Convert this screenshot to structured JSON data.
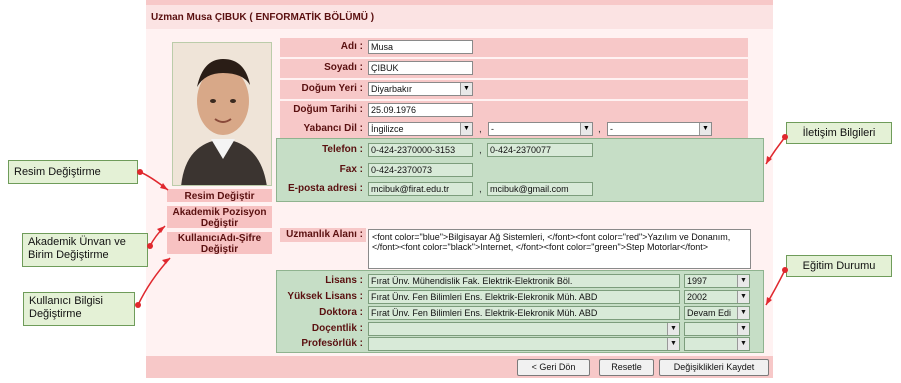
{
  "header": {
    "title": "Uzman  Musa ÇIBUK  ( ENFORMATİK BÖLÜMÜ )"
  },
  "sidebar": {
    "items": [
      {
        "label": "Resim Değiştir"
      },
      {
        "label": "Akademik Pozisyon Değiştir"
      },
      {
        "label": "KullanıcıAdı-Şifre Değiştir"
      }
    ]
  },
  "form": {
    "adi": {
      "label": "Adı :",
      "value": "Musa"
    },
    "soyadi": {
      "label": "Soyadı :",
      "value": "ÇIBUK"
    },
    "dogum_yeri": {
      "label": "Doğum Yeri :",
      "value": "Diyarbakır"
    },
    "dogum_tarihi": {
      "label": "Doğum Tarihi :",
      "value": "25.09.1976"
    },
    "yabanci_dil": {
      "label": "Yabancı Dil :",
      "values": [
        "İngilizce",
        "-",
        "-"
      ]
    },
    "telefon": {
      "label": "Telefon :",
      "values": [
        "0-424-2370000-3153",
        "0-424-2370077"
      ]
    },
    "fax": {
      "label": "Fax :",
      "value": "0-424-2370073"
    },
    "eposta": {
      "label": "E-posta adresi :",
      "values": [
        "mcibuk@firat.edu.tr",
        "mcibuk@gmail.com"
      ]
    },
    "uzmanlik": {
      "label": "Uzmanlık Alanı :",
      "value": "<font color=\"blue\">Bilgisayar Ağ Sistemleri, </font><font color=\"red\">Yazılım ve Donanım, </font><font color=\"black\">Internet, </font><font color=\"green\">Step Motorlar</font>"
    },
    "egitim": [
      {
        "label": "Lisans :",
        "school": "Fırat Ünv. Mühendislik Fak. Elektrik-Elektronik Böl.",
        "year": "1997"
      },
      {
        "label": "Yüksek Lisans :",
        "school": "Fırat Ünv. Fen Bilimleri Ens. Elektrik-Elekronik Müh. ABD",
        "year": "2002"
      },
      {
        "label": "Doktora :",
        "school": "Fırat Ünv. Fen Bilimleri Ens. Elektrik-Elekronik Müh. ABD",
        "year": "Devam Edi"
      },
      {
        "label": "Doçentlik :",
        "school": "",
        "year": ""
      },
      {
        "label": "Profesörlük :",
        "school": "",
        "year": ""
      }
    ]
  },
  "footer": {
    "back_label": "< Geri Dön",
    "reset_label": "Resetle",
    "save_label": "Değişiklikleri Kaydet"
  },
  "callouts": {
    "resim": "Resim Değiştirme",
    "akademik": "Akademik Ünvan ve Birim Değiştirme",
    "kullanici": "Kullanıcı Bilgisi Değiştirme",
    "iletisim": "İletişim Bilgileri",
    "egitim": "Eğitim Durumu"
  },
  "colors": {
    "header_bg": "#fbe3e3",
    "panel_bg": "#fff2f2",
    "label_bg": "#f7c8c8",
    "green_section": "#c6dec6",
    "label_text": "#5a1010",
    "callout_bg": "#e4f1d6",
    "arrow_red": "#e0282e"
  },
  "icons": {
    "dropdown": "chevron-down-icon",
    "arrow": "callout-arrow"
  }
}
